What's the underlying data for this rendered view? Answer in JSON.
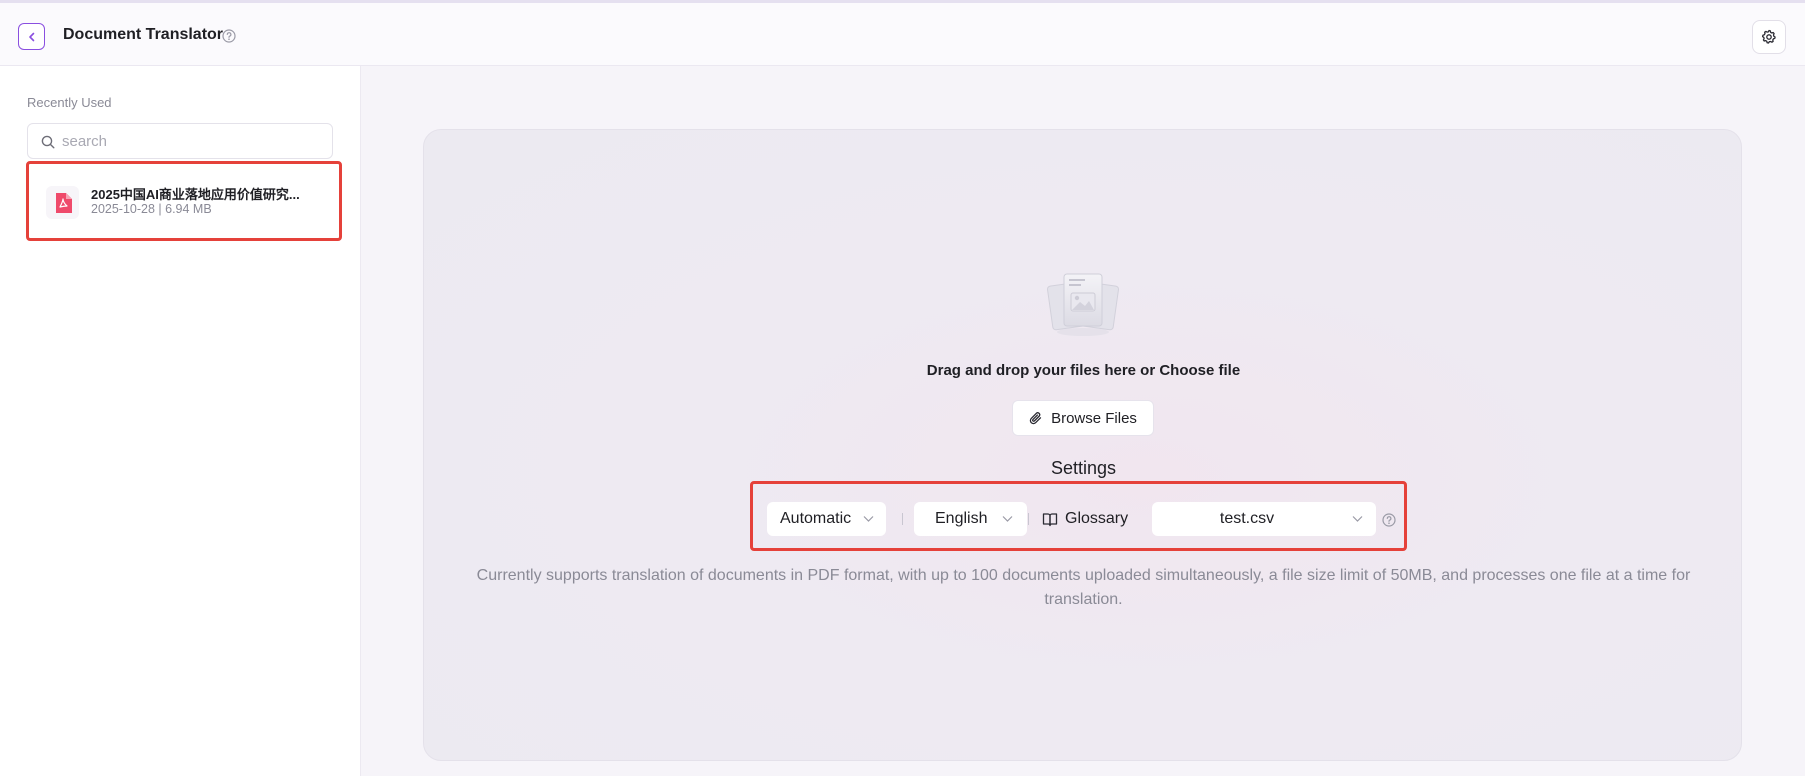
{
  "header": {
    "title": "Document Translator"
  },
  "sidebar": {
    "section_label": "Recently Used",
    "search_placeholder": "search",
    "files": [
      {
        "name": "2025中国AI商业落地应用价值研究...",
        "meta": "2025-10-28 | 6.94 MB"
      }
    ]
  },
  "upload": {
    "drop_text": "Drag and drop your files here or Choose file",
    "browse_label": "Browse Files"
  },
  "settings": {
    "title": "Settings",
    "source_language": "Automatic",
    "target_language": "English",
    "glossary_label": "Glossary",
    "glossary_file": "test.csv"
  },
  "note": "Currently supports translation of documents in PDF format, with up to 100 documents uploaded simultaneously, a file size limit of 50MB, and processes one file at a time for translation.",
  "colors": {
    "accent": "#8a4fe0",
    "highlight_border": "#e5413a",
    "pdf_icon": "#ef4a6b"
  }
}
